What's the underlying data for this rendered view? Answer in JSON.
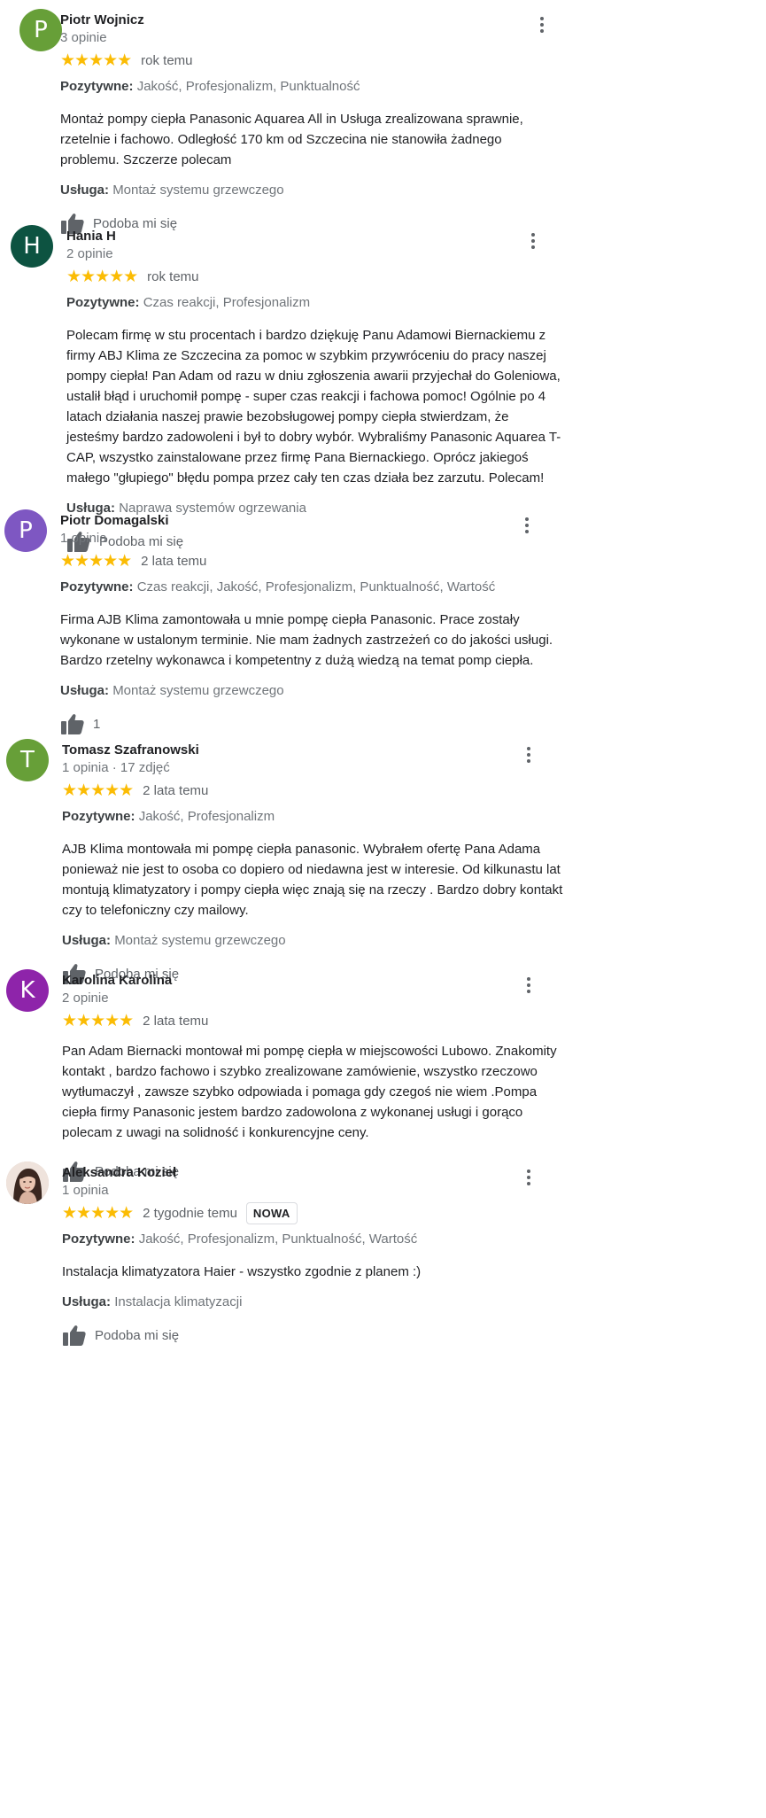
{
  "common": {
    "positive_label": "Pozytywne:",
    "service_label": "Usługa:",
    "stars": "★★★★★"
  },
  "colors": {
    "star": "#fbbc04",
    "avatar_green": "#679f38",
    "avatar_darkgreen": "#0d5341",
    "avatar_purple": "#7e57c2",
    "avatar_magenta": "#8e24aa"
  },
  "reviews": [
    {
      "name": "Piotr Wojnicz",
      "meta": "3 opinie",
      "avatar_letter": "P",
      "rating": 5,
      "time": "rok temu",
      "positive": "Jakość, Profesjonalizm, Punktualność",
      "text": "Montaż pompy ciepła Panasonic Aquarea All in Usługa zrealizowana sprawnie, rzetelnie i fachowo. Odległość 170 km od Szczecina nie stanowiła żadnego problemu.  Szczerze polecam",
      "service": "Montaż systemu grzewczego",
      "like": "Podoba mi się"
    },
    {
      "name": "Hania H",
      "meta": "2 opinie",
      "avatar_letter": "H",
      "rating": 5,
      "time": "rok temu",
      "positive": "Czas reakcji, Profesjonalizm",
      "text": "Polecam firmę w stu procentach i bardzo dziękuję Panu Adamowi Biernackiemu z firmy ABJ Klima ze Szczecina za pomoc w szybkim przywróceniu do pracy naszej pompy ciepła! Pan Adam od razu w dniu zgłoszenia awarii przyjechał do Goleniowa, ustalił błąd i uruchomił pompę - super czas reakcji i fachowa pomoc! Ogólnie po 4 latach działania naszej prawie bezobsługowej pompy ciepła stwierdzam, że jesteśmy bardzo zadowoleni i był to dobry wybór. Wybraliśmy Panasonic Aquarea T-CAP, wszystko zainstalowane przez firmę Pana Biernackiego. Oprócz jakiegoś małego \"głupiego\" błędu pompa przez cały ten czas działa bez zarzutu. Polecam!",
      "service": "Naprawa systemów ogrzewania",
      "like": "Podoba mi się"
    },
    {
      "name": "Piotr Domagalski",
      "meta": "1 opinia",
      "avatar_letter": "P",
      "rating": 5,
      "time": "2 lata temu",
      "positive": "Czas reakcji, Jakość, Profesjonalizm, Punktualność, Wartość",
      "text": "Firma AJB Klima zamontowała u mnie pompę ciepła Panasonic. Prace zostały wykonane w ustalonym terminie. Nie mam żadnych zastrzeżeń co do jakości usługi. Bardzo rzetelny wykonawca i kompetentny z dużą wiedzą na temat pomp ciepła.",
      "service": "Montaż systemu grzewczego",
      "like": "1"
    },
    {
      "name": "Tomasz Szafranowski",
      "meta": "1 opinia · 17 zdjęć",
      "avatar_letter": "T",
      "rating": 5,
      "time": "2 lata temu",
      "positive": "Jakość, Profesjonalizm",
      "text": "AJB Klima montowała mi pompę ciepła  panasonic. Wybrałem ofertę Pana Adama ponieważ nie jest to osoba co dopiero od niedawna jest w interesie. Od kilkunastu lat montują klimatyzatory i pompy ciepła więc znają się na rzeczy . Bardzo dobry kontakt czy to telefoniczny czy mailowy.",
      "service": "Montaż systemu grzewczego",
      "like": "Podoba mi się"
    },
    {
      "name": "Karolina Karolina",
      "meta": "2 opinie",
      "avatar_letter": "K",
      "rating": 5,
      "time": "2 lata temu",
      "text": "Pan Adam Biernacki montował mi pompę ciepła w miejscowości Lubowo. Znakomity kontakt , bardzo fachowo i szybko zrealizowane zamówienie, wszystko rzeczowo  wytłumaczył , zawsze szybko odpowiada i pomaga gdy czegoś nie wiem .Pompa ciepła firmy Panasonic jestem bardzo zadowolona z wykonanej usługi i gorąco polecam z uwagi na solidność i konkurencyjne ceny.",
      "like": "Podoba mi się"
    },
    {
      "name": "Aleksandra Kozieł",
      "meta": "1 opinia",
      "avatar_letter": "",
      "rating": 5,
      "time": "2 tygodnie temu",
      "badge": "NOWA",
      "positive": "Jakość, Profesjonalizm, Punktualność, Wartość",
      "text": "Instalacja klimatyzatora Haier - wszystko zgodnie z planem :)",
      "service": "Instalacja klimatyzacji",
      "like": "Podoba mi się"
    }
  ]
}
